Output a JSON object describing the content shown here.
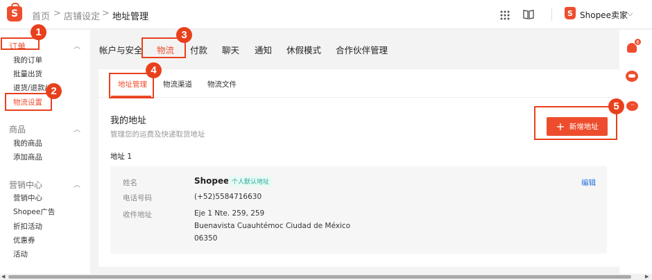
{
  "breadcrumb": {
    "home": "首页",
    "shop_settings": "店铺设定",
    "current": "地址管理",
    "separator": ">"
  },
  "header": {
    "shop_name": "Shopee卖家",
    "logo_letter": "S",
    "apps_icon": "grid-icon",
    "help_icon": "book-icon",
    "caret": "⌵"
  },
  "sidebar": {
    "groups": [
      {
        "title": "订单",
        "items": [
          "我的订单",
          "批量出货",
          "退货/退款/",
          "物流设置"
        ]
      },
      {
        "title": "商品",
        "items": [
          "我的商品",
          "添加商品"
        ]
      },
      {
        "title": "营销中心",
        "items": [
          "营销中心",
          "Shopee广告",
          "折扣活动",
          "优惠券",
          "活动"
        ]
      }
    ],
    "active_item": "物流设置"
  },
  "main_tabs": [
    "帐户与安全",
    "物流",
    "付款",
    "聊天",
    "通知",
    "休假模式",
    "合作伙伴管理"
  ],
  "active_main_tab": "物流",
  "sub_tabs": [
    "地址管理",
    "物流渠道",
    "物流文件"
  ],
  "active_sub_tab": "地址管理",
  "section": {
    "title": "我的地址",
    "description": "管理您的运费及快递取货地址",
    "add_button": "新增地址",
    "add_icon": "+"
  },
  "address": {
    "heading": "地址 1",
    "fields": {
      "name_label": "姓名",
      "phone_label": "电话号码",
      "addr_label": "收件地址"
    },
    "name": "Shopee",
    "badge": "个人默认地址",
    "phone": "(+52)5584716630",
    "line1": "Eje 1 Nte. 259, 259",
    "line2": "Buenavista Cuauhtémoc Ciudad de México",
    "zip": "06350",
    "edit": "编辑"
  },
  "right_rail": {
    "notification_count": "6",
    "chat_glyph": "···"
  },
  "callouts": [
    "1",
    "2",
    "3",
    "4",
    "5"
  ],
  "colors": {
    "accent": "#ee4d2d",
    "callout": "#e8401c",
    "badge_green": "#26aa99",
    "link": "#2673dd"
  }
}
